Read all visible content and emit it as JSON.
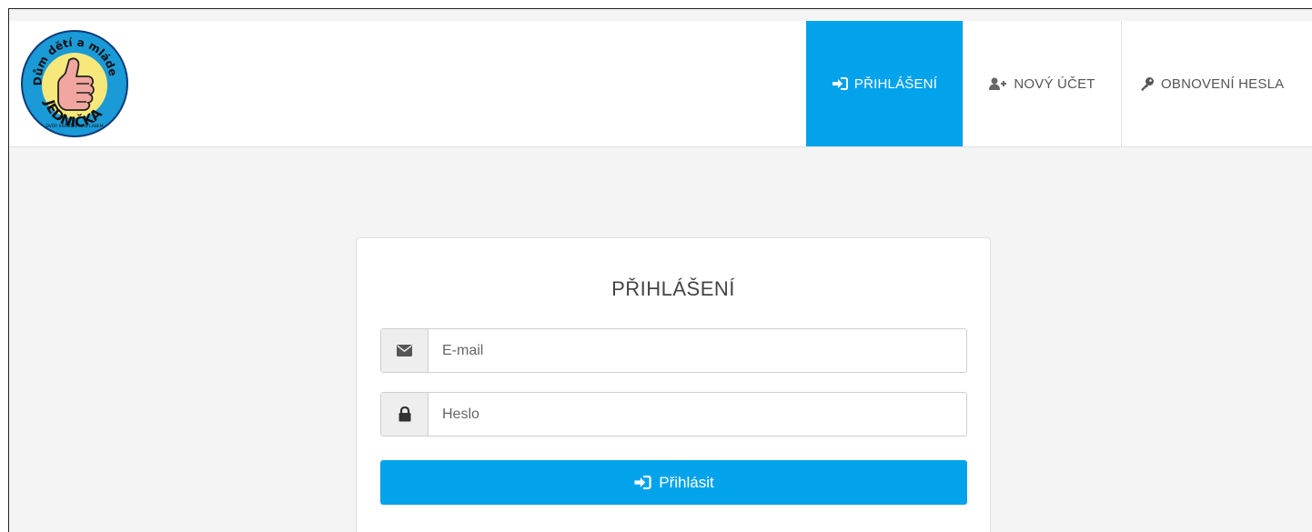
{
  "brand": {
    "logo_icon": "thumbs-up-logo",
    "logo_text_top": "Dům dětí a mládeže",
    "logo_text_main": "JEDNIČKA",
    "logo_text_bottom": "DVŮR KRÁLOVÉ NAD LABEM"
  },
  "nav": {
    "login": {
      "label": "PŘIHLÁŠENÍ",
      "icon": "sign-in-icon",
      "active": true
    },
    "new_account": {
      "label": "NOVÝ ÚČET",
      "icon": "user-plus-icon"
    },
    "password_reset": {
      "label": "OBNOVENÍ HESLA",
      "icon": "key-icon"
    }
  },
  "login_form": {
    "title": "PŘIHLÁŠENÍ",
    "email": {
      "placeholder": "E-mail",
      "value": "",
      "icon": "envelope-icon"
    },
    "password": {
      "placeholder": "Heslo",
      "value": "",
      "icon": "lock-icon"
    },
    "submit_label": "Přihlásit",
    "submit_icon": "sign-in-icon"
  },
  "colors": {
    "accent": "#03a3ec",
    "background": "#f4f4f4",
    "card": "#ffffff"
  }
}
